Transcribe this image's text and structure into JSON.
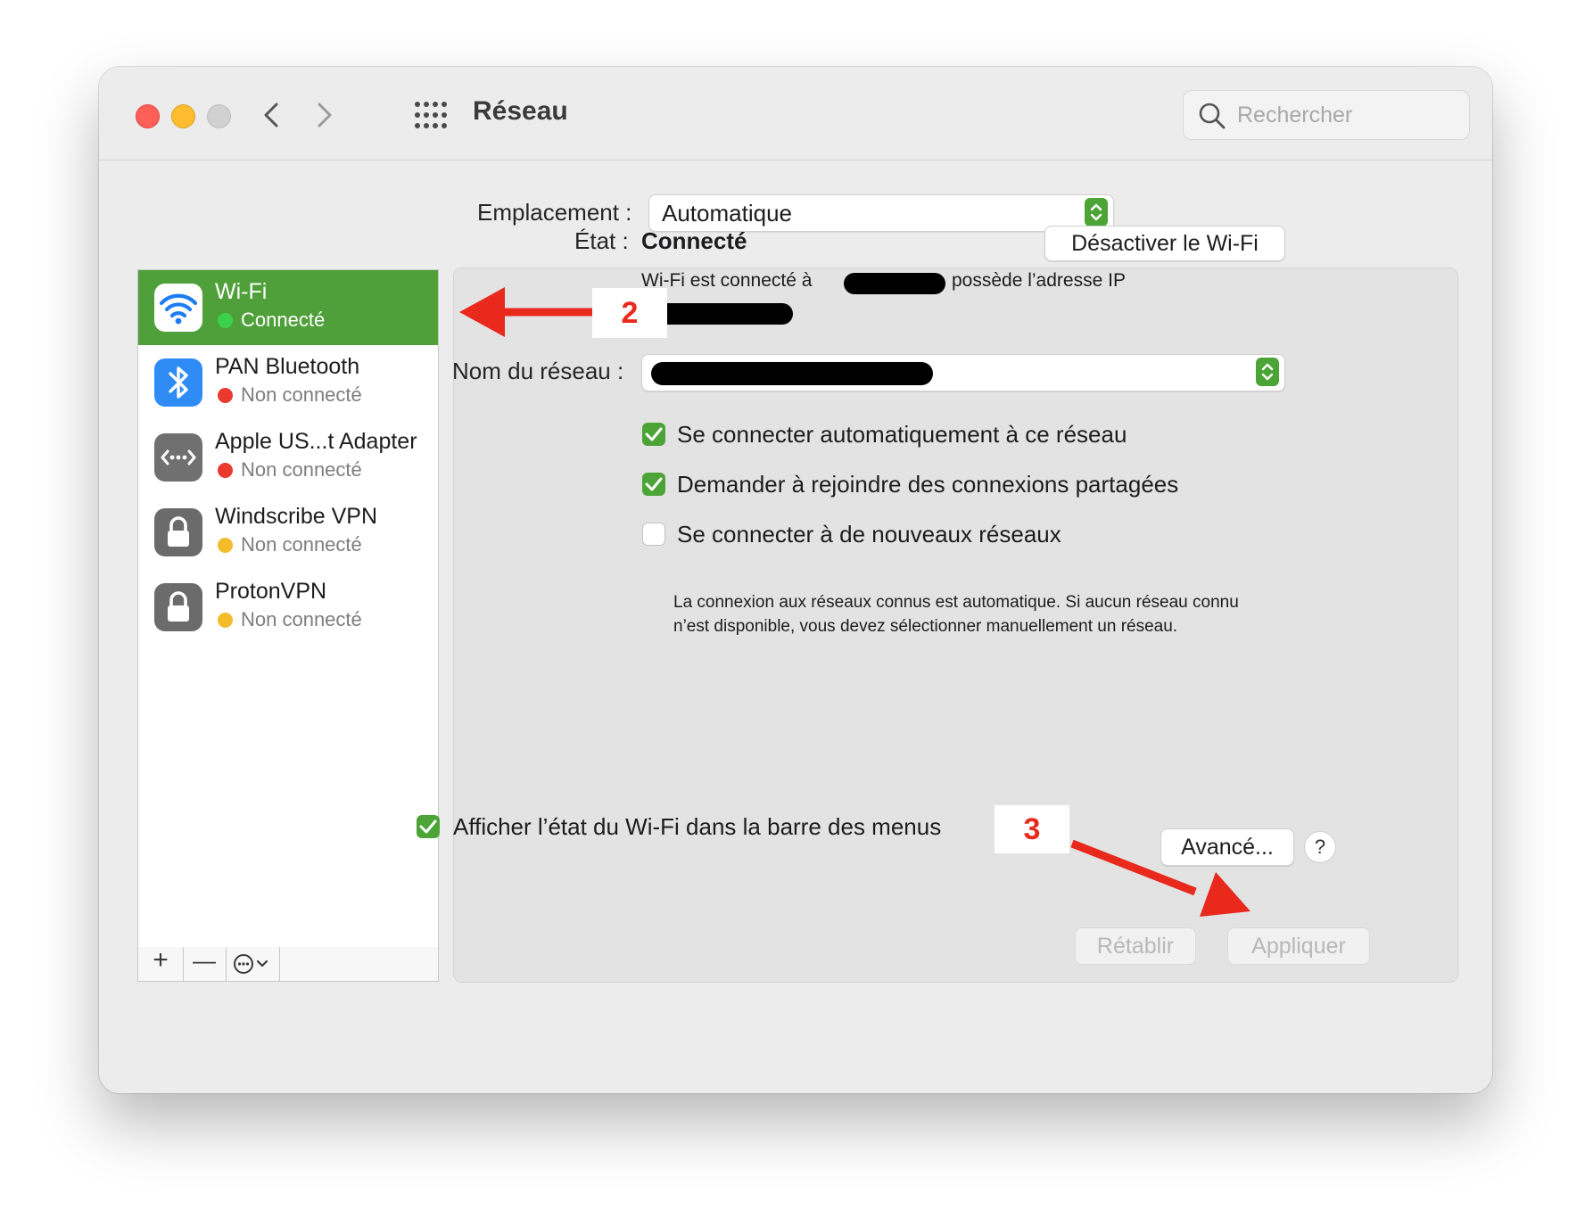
{
  "window": {
    "title": "Réseau",
    "search_placeholder": "Rechercher"
  },
  "location": {
    "label": "Emplacement :",
    "value": "Automatique"
  },
  "sidebar": {
    "items": [
      {
        "name": "Wi-Fi",
        "status": "Connecté",
        "status_color": "#3bd14a",
        "icon": "wifi-icon",
        "selected": true
      },
      {
        "name": "PAN Bluetooth",
        "status": "Non connecté",
        "status_color": "#ea3a30",
        "icon": "bluetooth-icon"
      },
      {
        "name": "Apple US...t Adapter",
        "status": "Non connecté",
        "status_color": "#ea3a30",
        "icon": "ethernet-adapter-icon"
      },
      {
        "name": "Windscribe VPN",
        "status": "Non connecté",
        "status_color": "#f4bb2b",
        "icon": "lock-icon"
      },
      {
        "name": "ProtonVPN",
        "status": "Non connecté",
        "status_color": "#f4bb2b",
        "icon": "lock-icon"
      }
    ],
    "toolbar": {
      "add": "+",
      "remove": "—"
    }
  },
  "detail": {
    "state_label": "État :",
    "state_value": "Connecté",
    "toggle_button": "Désactiver le Wi-Fi",
    "desc_part1": "Wi-Fi est connecté à",
    "desc_part2": "possède l’adresse IP",
    "network_label": "Nom du réseau :",
    "checkboxes": [
      {
        "label": "Se connecter automatiquement à ce réseau",
        "checked": true
      },
      {
        "label": "Demander à rejoindre des connexions partagées",
        "checked": true
      },
      {
        "label": "Se connecter à de nouveaux réseaux",
        "checked": false
      }
    ],
    "help_text": "La connexion aux réseaux connus est automatique. Si aucun réseau connu n’est disponible, vous devez sélectionner manuellement un réseau.",
    "menubar_checkbox": {
      "label": "Afficher l’état du Wi-Fi dans la barre des menus",
      "checked": true
    },
    "advanced_button": "Avancé...",
    "help_button": "?"
  },
  "footer": {
    "revert_button": "Rétablir",
    "apply_button": "Appliquer"
  },
  "annotations": {
    "step2": "2",
    "step3": "3",
    "color": "#e8291c"
  },
  "colors": {
    "accent_green": "#4fa03a",
    "checkbox_green": "#4ca437"
  }
}
